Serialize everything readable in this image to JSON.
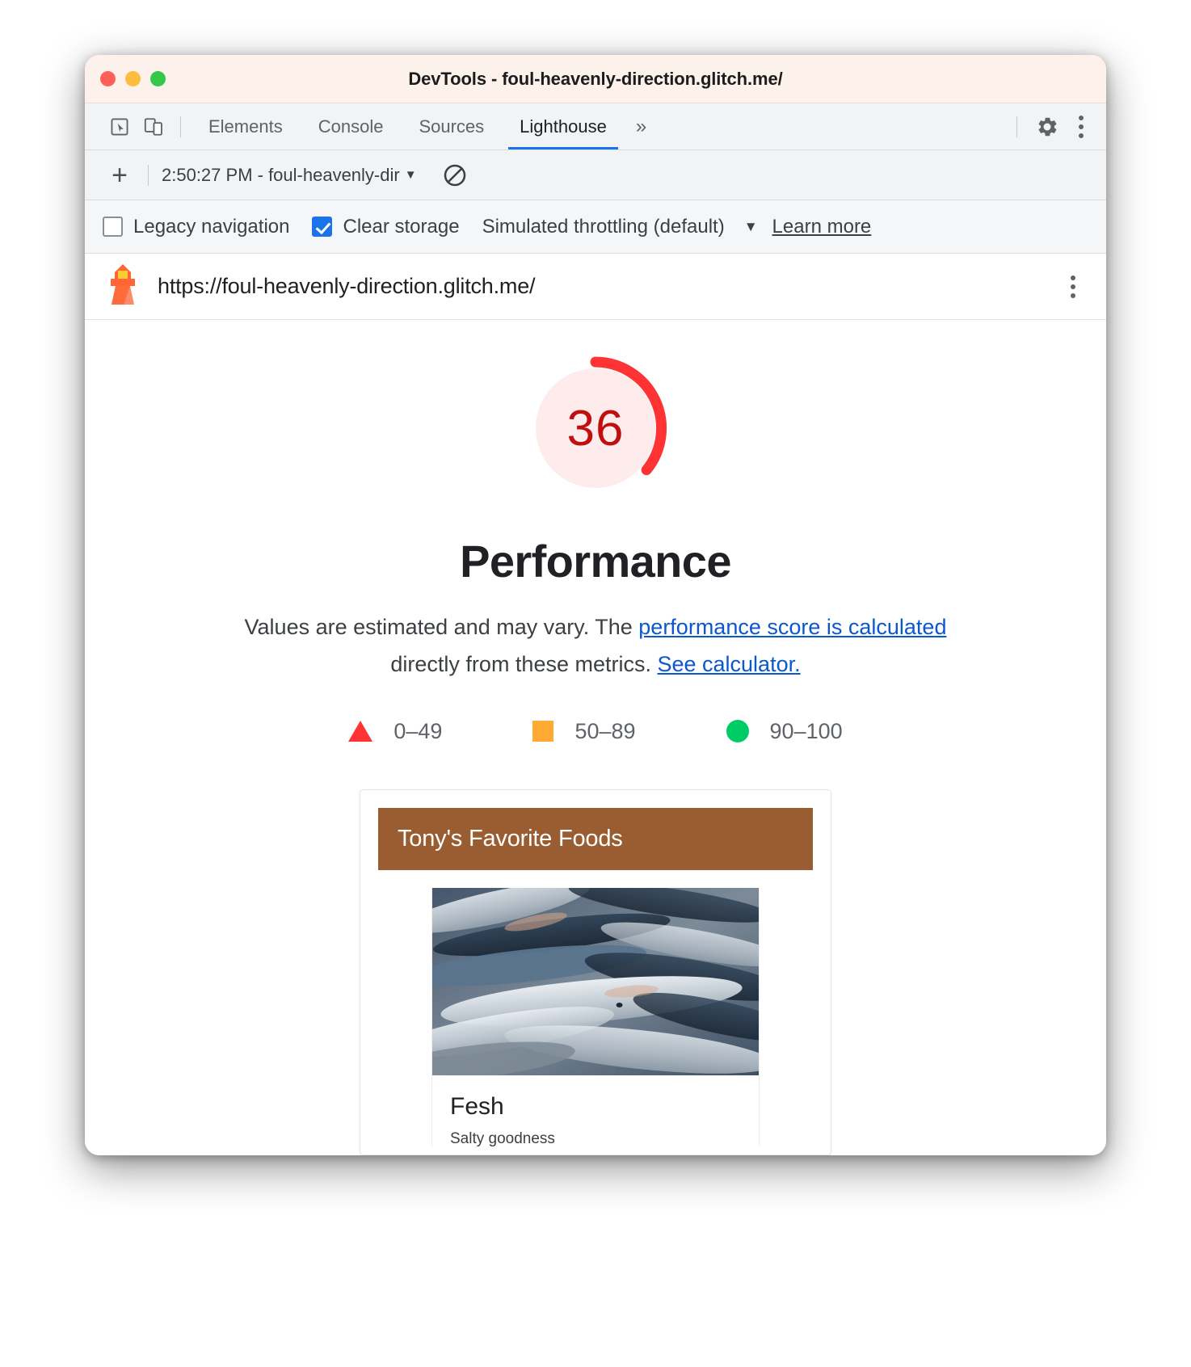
{
  "window": {
    "title": "DevTools - foul-heavenly-direction.glitch.me/",
    "traffic_lights": [
      "close",
      "minimize",
      "zoom"
    ]
  },
  "devtools": {
    "inspect_icon": "cursor-select-icon",
    "device_toolbar_icon": "device-toggle-icon",
    "tabs": [
      {
        "label": "Elements",
        "active": false
      },
      {
        "label": "Console",
        "active": false
      },
      {
        "label": "Sources",
        "active": false
      },
      {
        "label": "Lighthouse",
        "active": true
      }
    ],
    "more_tabs_label": "»",
    "settings_icon": "gear-icon",
    "menu_icon": "kebab-menu-icon"
  },
  "lighthouse_toolbar": {
    "add_label": "+",
    "report_name": "2:50:27 PM - foul-heavenly-dir",
    "caret": "▼",
    "clear_icon": "no-entry-icon"
  },
  "settings": {
    "legacy_navigation": {
      "label": "Legacy navigation",
      "checked": false
    },
    "clear_storage": {
      "label": "Clear storage",
      "checked": true
    },
    "throttling": {
      "label": "Simulated throttling (default)",
      "caret": "▼"
    },
    "learn_more": "Learn more"
  },
  "urlbar": {
    "icon": "lighthouse-icon",
    "url": "https://foul-heavenly-direction.glitch.me/",
    "menu_icon": "kebab-menu-icon"
  },
  "report": {
    "score": "36",
    "score_value": 36,
    "category": "Performance",
    "gauge_color": "#f33",
    "gauge_track_color": "#fdeceb",
    "score_text_color": "#c00f0f",
    "description": {
      "part1": "Values are estimated and may vary. The ",
      "link1": "performance score is calculated",
      "part2": " directly from these metrics. ",
      "link2": "See calculator.",
      "link_color": "#0b57d0"
    },
    "legend": [
      {
        "shape": "triangle",
        "color": "#f33",
        "range": "0–49"
      },
      {
        "shape": "square",
        "color": "#fa3",
        "range": "50–89"
      },
      {
        "shape": "circle",
        "color": "#0c6",
        "range": "90–100"
      }
    ]
  },
  "preview": {
    "banner_title": "Tony's Favorite Foods",
    "banner_color": "#9a5d32",
    "photo_alt": "pile-of-fish-photo",
    "item_name": "Fesh",
    "item_subtitle": "Salty goodness"
  }
}
